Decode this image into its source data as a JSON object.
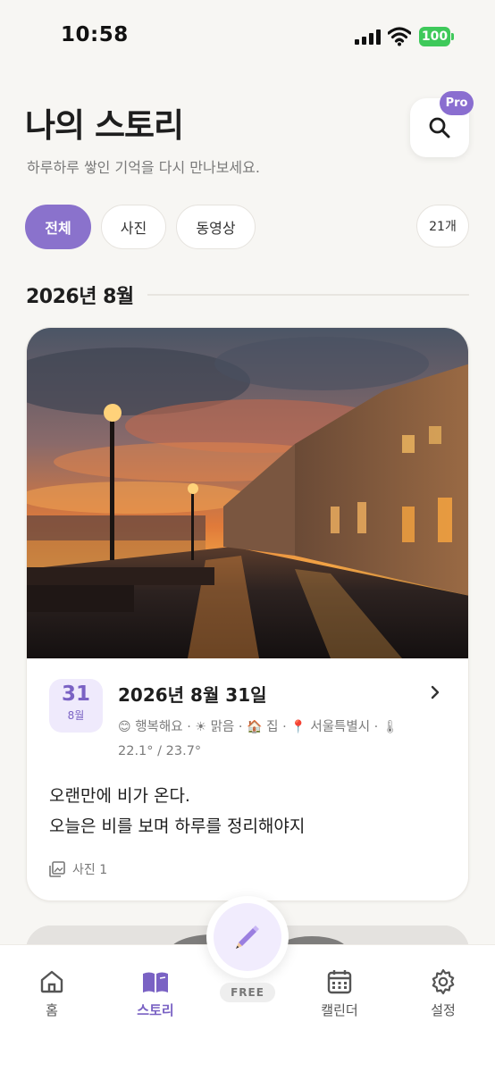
{
  "status_bar": {
    "time": "10:58",
    "battery": "100"
  },
  "header": {
    "title": "나의 스토리",
    "subtitle": "하루하루 쌓인 기억을 다시 만나보세요.",
    "search_icon": "search-icon",
    "pro_badge": "Pro"
  },
  "filters": {
    "items": [
      {
        "label": "전체",
        "active": true
      },
      {
        "label": "사진",
        "active": false
      },
      {
        "label": "동영상",
        "active": false
      }
    ],
    "count": "21개"
  },
  "section": {
    "title": "2026년 8월"
  },
  "entry": {
    "day": "31",
    "month": "8월",
    "date_title": "2026년 8월 31일",
    "mood": "행복해요",
    "weather": "맑음",
    "place": "집",
    "location": "서울특별시",
    "temperature": "22.1° / 23.7°",
    "text_line1": "오랜만에 비가 온다.",
    "text_line2": "오늘은 비를 보며 하루를 정리해야지",
    "photo_count": "사진 1"
  },
  "tab_bar": {
    "tabs": [
      {
        "label": "홈",
        "icon": "home-icon",
        "active": false
      },
      {
        "label": "스토리",
        "icon": "book-icon",
        "active": true
      },
      {
        "label": "캘린더",
        "icon": "calendar-icon",
        "active": false
      },
      {
        "label": "설정",
        "icon": "gear-icon",
        "active": false
      }
    ],
    "fab_icon": "pencil-icon",
    "free_badge": "FREE"
  },
  "colors": {
    "accent": "#8a72cc",
    "accent_light": "#efeafc",
    "background": "#f7f6f3",
    "battery": "#3ec95a"
  }
}
